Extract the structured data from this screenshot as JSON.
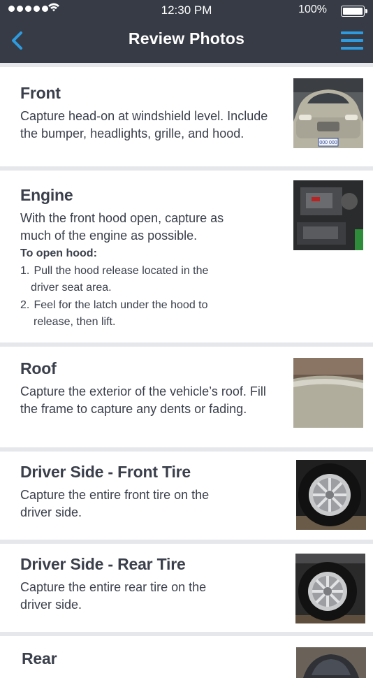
{
  "status_bar": {
    "time": "12:30 PM",
    "battery": "100%",
    "icons": [
      "signal-dots",
      "wifi-icon",
      "battery-icon"
    ]
  },
  "nav": {
    "title": "Review Photos",
    "back_icon": "chevron-left-icon",
    "menu_icon": "hamburger-menu-icon",
    "accent_color": "#2e9be0",
    "bar_color": "#363b45"
  },
  "cards": [
    {
      "title": "Front",
      "description": "Capture head-on at windshield level. Include the bumper, headlights, grille, and hood.",
      "thumbnail": "front-car-photo"
    },
    {
      "title": "Engine",
      "description": "With the front hood open, capture as much of the engine as possible.",
      "instructions_title": "To open hood:",
      "steps": [
        {
          "num": "1.",
          "text": "Pull the hood release located in the",
          "text2": "driver seat area."
        },
        {
          "num": "2.",
          "text": "Feel for the latch under the hood to",
          "text2": "release, then lift."
        }
      ],
      "thumbnail": "engine-photo"
    },
    {
      "title": "Roof",
      "description": "Capture the exterior of the vehicle’s roof. Fill the frame to capture any dents or fading.",
      "thumbnail": "roof-photo"
    },
    {
      "title": "Driver Side - Front Tire",
      "description": "Capture the entire front tire on the driver side.",
      "thumbnail": "front-tire-photo"
    },
    {
      "title": "Driver Side - Rear Tire",
      "description": "Capture the entire rear tire on the driver side.",
      "thumbnail": "rear-tire-photo"
    },
    {
      "title": "Rear",
      "thumbnail": "rear-photo"
    }
  ]
}
